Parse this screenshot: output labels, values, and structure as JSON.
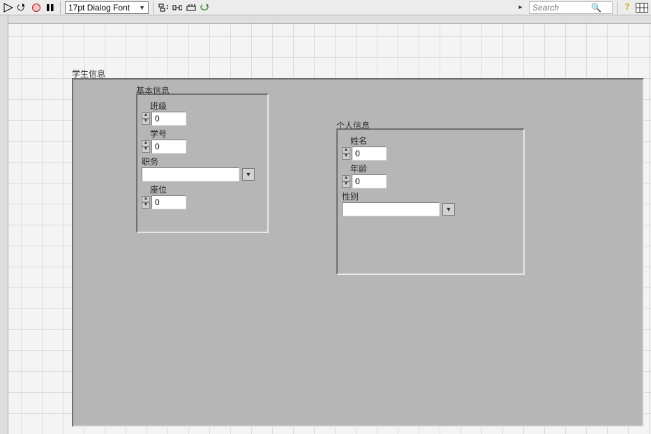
{
  "toolbar": {
    "font_value": "17pt Dialog Font",
    "search_placeholder": "Search"
  },
  "outer": {
    "title": "学生信息"
  },
  "basic": {
    "title": "基本信息",
    "class": {
      "label": "班级",
      "value": "0"
    },
    "id": {
      "label": "学号",
      "value": "0"
    },
    "role": {
      "label": "职务",
      "value": ""
    },
    "seat": {
      "label": "座位",
      "value": "0"
    }
  },
  "personal": {
    "title": "个人信息",
    "name": {
      "label": "姓名",
      "value": "0"
    },
    "age": {
      "label": "年龄",
      "value": "0"
    },
    "gender": {
      "label": "性别",
      "value": ""
    }
  }
}
